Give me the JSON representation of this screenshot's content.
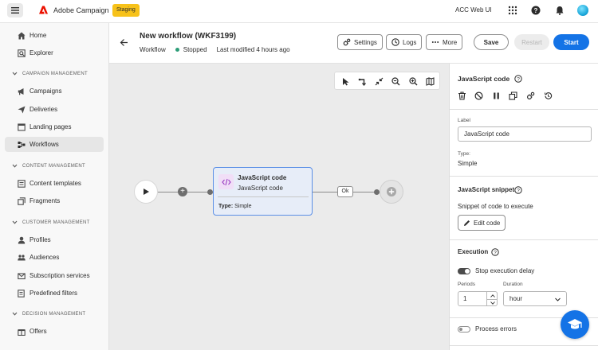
{
  "topbar": {
    "app_name": "Adobe Campaign",
    "env_badge": "Staging",
    "org_name": "ACC Web UI"
  },
  "sidebar": {
    "items": [
      {
        "label": "Home",
        "icon": "home-icon"
      },
      {
        "label": "Explorer",
        "icon": "explorer-icon"
      },
      {
        "label": "Campaigns",
        "icon": "campaigns-icon"
      },
      {
        "label": "Deliveries",
        "icon": "send-icon"
      },
      {
        "label": "Landing pages",
        "icon": "landing-page-icon"
      },
      {
        "label": "Workflows",
        "icon": "workflow-icon",
        "active": true
      },
      {
        "label": "Content templates",
        "icon": "template-icon"
      },
      {
        "label": "Fragments",
        "icon": "fragments-icon"
      },
      {
        "label": "Profiles",
        "icon": "user-icon"
      },
      {
        "label": "Audiences",
        "icon": "audiences-icon"
      },
      {
        "label": "Subscription services",
        "icon": "subscription-icon"
      },
      {
        "label": "Predefined filters",
        "icon": "filter-icon"
      },
      {
        "label": "Offers",
        "icon": "offers-icon"
      }
    ],
    "sections": {
      "campaign": "CAMPAIGN MANAGEMENT",
      "content": "CONTENT MANAGEMENT",
      "customer": "CUSTOMER MANAGEMENT",
      "decision": "DECISION MANAGEMENT"
    }
  },
  "workflow": {
    "title": "New workflow (WKF3199)",
    "type": "Workflow",
    "status": "Stopped",
    "status_color": "#2d9d78",
    "last_modified": "Last modified 4 hours ago",
    "buttons": {
      "settings": "Settings",
      "logs": "Logs",
      "more": "More",
      "save": "Save",
      "restart": "Restart",
      "start": "Start"
    }
  },
  "canvas": {
    "activity": {
      "title": "JavaScript code",
      "subtitle": "JavaScript code",
      "type_label": "Type:",
      "type_value": "Simple"
    },
    "transition_label": "Ok"
  },
  "panel": {
    "title": "JavaScript code",
    "label_caption": "Label",
    "label_value": "JavaScript code",
    "type_caption": "Type:",
    "type_value": "Simple",
    "snippet_title": "JavaScript snippet",
    "snippet_desc": "Snippet of code to execute",
    "edit_code": "Edit code",
    "execution_title": "Execution",
    "stop_delay_label": "Stop execution delay",
    "stop_delay_enabled": true,
    "periods_label": "Periods",
    "periods_value": "1",
    "duration_label": "Duration",
    "duration_value": "hour",
    "process_errors_label": "Process errors",
    "process_errors_enabled": false
  },
  "colors": {
    "accent": "#1473e6",
    "staging": "#f7c21a",
    "activity_border": "#5b8fe6"
  }
}
